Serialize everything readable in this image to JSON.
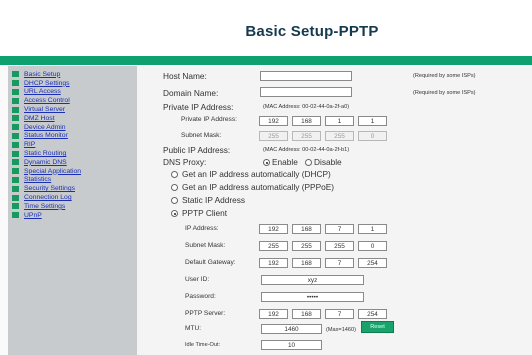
{
  "page": {
    "title": "Basic Setup-PPTP"
  },
  "colors": {
    "accent": "#0fa06f",
    "sidebar_bg": "#c8cbcd",
    "link": "#1a2fb4"
  },
  "sidebar": {
    "items": [
      {
        "label": "Basic Setup"
      },
      {
        "label": "DHCP Settings"
      },
      {
        "label": "URL Access"
      },
      {
        "label": "Access Control"
      },
      {
        "label": "Virtual Server"
      },
      {
        "label": "DMZ Host"
      },
      {
        "label": "Device Admin"
      },
      {
        "label": "Status Monitor"
      },
      {
        "label": "RIP"
      },
      {
        "label": "Static Routing"
      },
      {
        "label": "Dynamic DNS"
      },
      {
        "label": "Special Application"
      },
      {
        "label": "Statistics"
      },
      {
        "label": "Security Settings"
      },
      {
        "label": "Connection Log"
      },
      {
        "label": "Time Settings"
      },
      {
        "label": "UPnP"
      }
    ]
  },
  "form": {
    "host_name_label": "Host Name:",
    "host_name_value": "",
    "domain_name_label": "Domain Name:",
    "domain_name_value": "",
    "required_note_1": "(Required by some ISPs)",
    "required_note_2": "(Required by some ISPs)",
    "private_ip_label": "Private IP Address:",
    "private_mac": "(MAC Address: 00-02-44-0a-2f-a0)",
    "private_ip_sub_label": "Private IP Address:",
    "private_ip": [
      "192",
      "168",
      "1",
      "1"
    ],
    "subnet_mask_label": "Subnet Mask:",
    "subnet_mask": [
      "255",
      "255",
      "255",
      "0"
    ],
    "public_ip_label": "Public IP Address:",
    "public_mac": "(MAC Address: 00-02-44-0a-2f-b1)",
    "dns_proxy_label": "DNS Proxy:",
    "dns_enable": "Enable",
    "dns_disable": "Disable",
    "options": [
      "Get an IP address automatically (DHCP)",
      "Get an IP address automatically (PPPoE)",
      "Static IP Address",
      "PPTP Client"
    ],
    "ip_address_label": "IP Address:",
    "ip_address": [
      "192",
      "168",
      "7",
      "1"
    ],
    "pptp_subnet_label": "Subnet Mask:",
    "pptp_subnet": [
      "255",
      "255",
      "255",
      "0"
    ],
    "gateway_label": "Default Gateway:",
    "gateway": [
      "192",
      "168",
      "7",
      "254"
    ],
    "user_id_label": "User ID:",
    "user_id_value": "xyz",
    "password_label": "Password:",
    "password_value": "•••••",
    "pptp_server_label": "PPTP Server:",
    "pptp_server": [
      "192",
      "168",
      "7",
      "254"
    ],
    "mtu_label": "MTU:",
    "mtu_value": "1460",
    "mtu_note": "(Max=1460)",
    "reset_button": "Reset",
    "idle_timeout_label": "Idle Time-Out:",
    "idle_timeout_value": "10"
  }
}
